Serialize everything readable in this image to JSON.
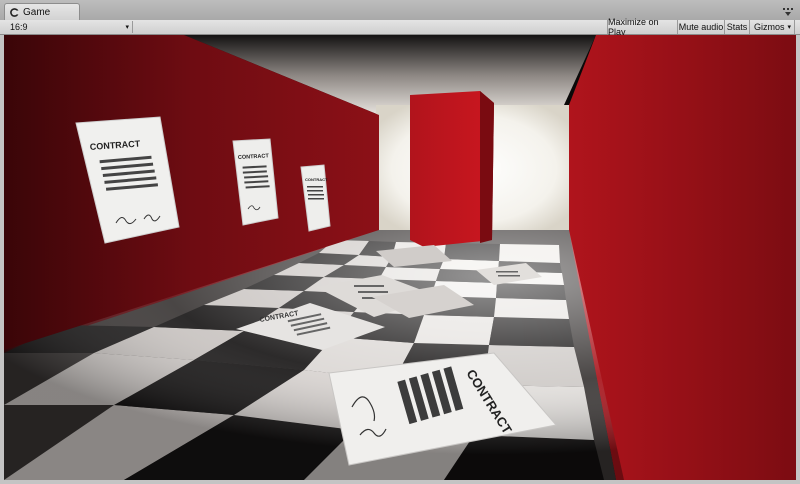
{
  "tab": {
    "title": "Game",
    "icon": "game-view-icon",
    "menu_icon": "tab-menu-icon"
  },
  "toolbar": {
    "aspect": {
      "value": "16:9",
      "icon": "chevron-down-icon"
    },
    "maximize_on_play": "Maximize on Play",
    "mute_audio": "Mute audio",
    "stats": "Stats",
    "gizmos": "Gizmos"
  },
  "scene": {
    "wall_poster_text": "CONTRACT",
    "colors": {
      "wall_red": "#a5121a",
      "ceiling": "#e8e4df",
      "floor_light": "#d8d3cf",
      "floor_dark": "#1a1818",
      "paper": "#f2f2f0"
    }
  }
}
